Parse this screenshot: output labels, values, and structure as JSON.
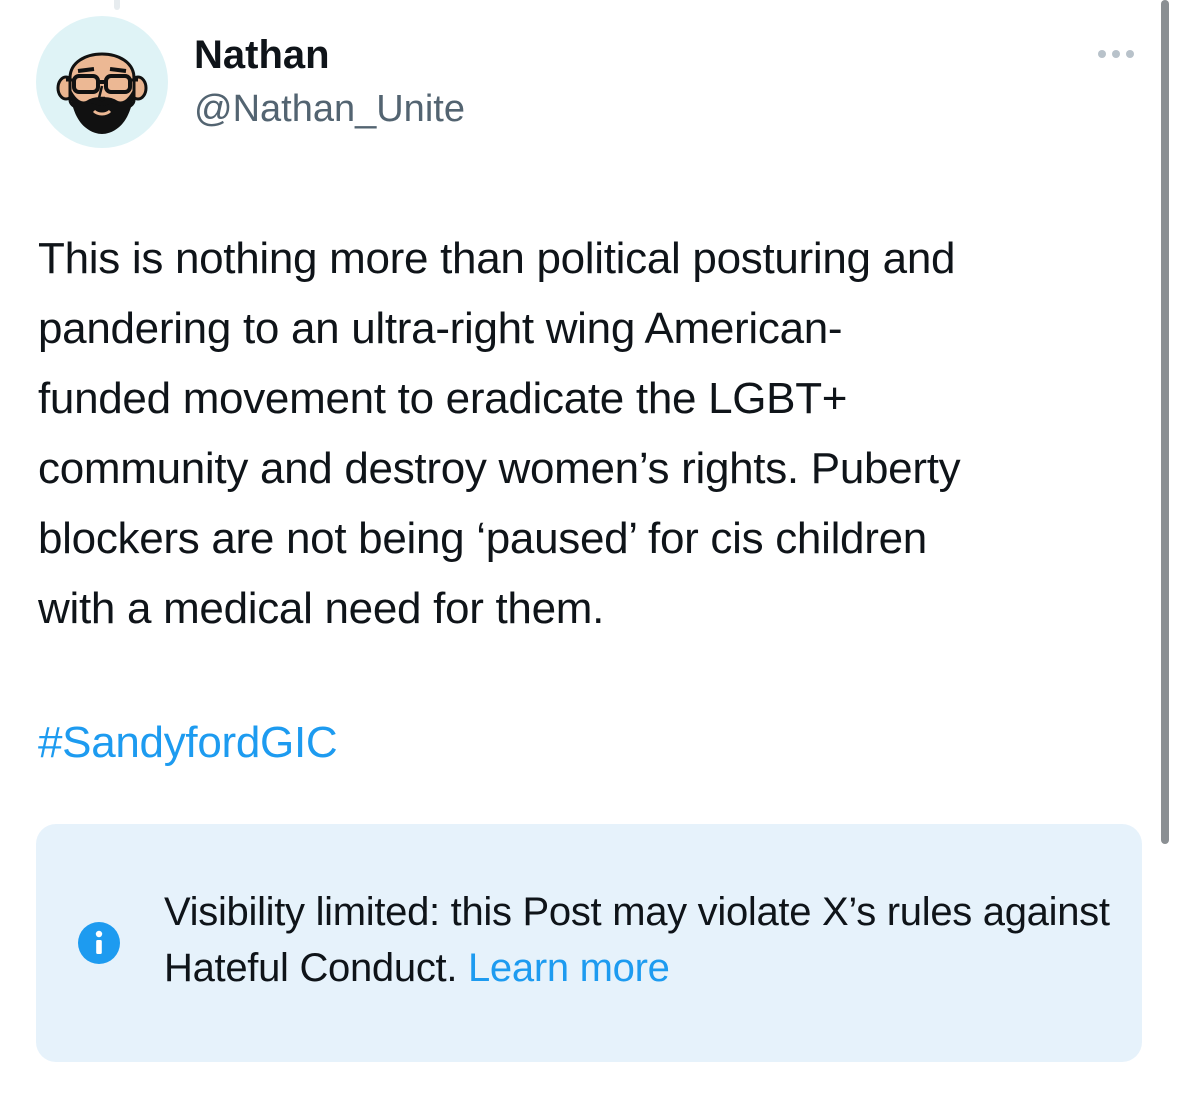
{
  "post": {
    "author": {
      "display_name": "Nathan",
      "handle": "@Nathan_Unite",
      "avatar_icon": "bearded-man-glasses-avatar"
    },
    "more_icon": "more-dots-icon",
    "text": "This is nothing more than political posturing and\npandering to an ultra-right wing American-\nfunded movement to eradicate the LGBT+\ncommunity and destroy women’s rights. Puberty\nblockers are not being ‘paused’ for cis children\nwith a medical need for them.",
    "hashtag": "#SandyfordGIC"
  },
  "notice": {
    "icon": "info-icon",
    "text": "Visibility limited: this Post may violate X’s rules against Hateful Conduct.",
    "link_label": "Learn more"
  },
  "colors": {
    "link": "#1d9bf0",
    "secondary_text": "#536471",
    "notice_background": "#e6f2fb",
    "avatar_background": "#dff3f6"
  }
}
